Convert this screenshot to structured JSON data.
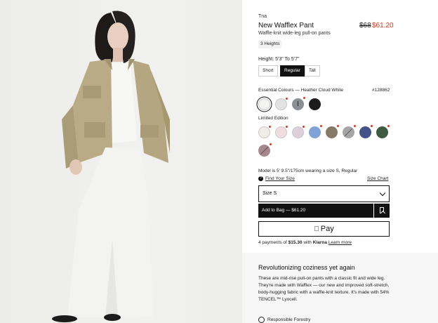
{
  "product": {
    "brand": "Tna",
    "title": "New Wafflex Pant",
    "price_old": "$68",
    "price_new": "$61.20",
    "subtitle": "Waffle-knit wide-leg pull-on pants",
    "badge": "3 Heights"
  },
  "height": {
    "label": "Height: 5'3\" To 5'7\"",
    "options": [
      "Short",
      "Regular",
      "Tall"
    ],
    "selected": "Regular"
  },
  "colours": {
    "essential_label": "Essential Colours — Heather Cloud White",
    "code": "#128862",
    "essential": [
      {
        "name": "heather-cloud-white",
        "hex": "#f4f4f2"
      },
      {
        "name": "light-grey",
        "hex": "#e2e4e4"
      },
      {
        "name": "grey",
        "hex": "#8a8f95"
      },
      {
        "name": "black",
        "hex": "#1c1c1c"
      }
    ],
    "limited_label": "Limited Edition",
    "limited": [
      {
        "name": "cream",
        "hex": "#f0ece6"
      },
      {
        "name": "blush",
        "hex": "#f1dde0"
      },
      {
        "name": "lilac",
        "hex": "#ddd0dc"
      },
      {
        "name": "blue",
        "hex": "#7ea3d6"
      },
      {
        "name": "olive",
        "hex": "#857a66"
      },
      {
        "name": "stone",
        "hex": "#a6a6a6"
      },
      {
        "name": "navy",
        "hex": "#435389"
      },
      {
        "name": "green",
        "hex": "#3e5b41"
      },
      {
        "name": "mauve",
        "hex": "#a88890"
      }
    ]
  },
  "fit": {
    "model_info": "Model is 5' 9.5\"/175cm wearing a size S, Regular",
    "find_size": "Find Your Size",
    "size_chart": "Size Chart"
  },
  "purchase": {
    "size_value": "Size S",
    "add_to_bag": "Add to Bag — $61.20",
    "apple_pay": "Pay",
    "klarna_prefix": "4 payments of ",
    "klarna_amount": "$15.30",
    "klarna_with": " with ",
    "klarna_brand": "Klarna",
    "klarna_learn": "Learn more"
  },
  "description": {
    "heading": "Revolutionizing coziness yet again",
    "body": "These are mid-rise pull-on pants with a classic fit and wide leg. They're made with Wafflex — our new and improved soft-stretch, body-hugging fabric with a waffle-knit texture. It's made with 54% TENCEL™ Lyocell.",
    "feature": "Responsible Forestry"
  },
  "colors": {
    "accent_sale": "#d9381e",
    "primary_button": "#111111"
  }
}
